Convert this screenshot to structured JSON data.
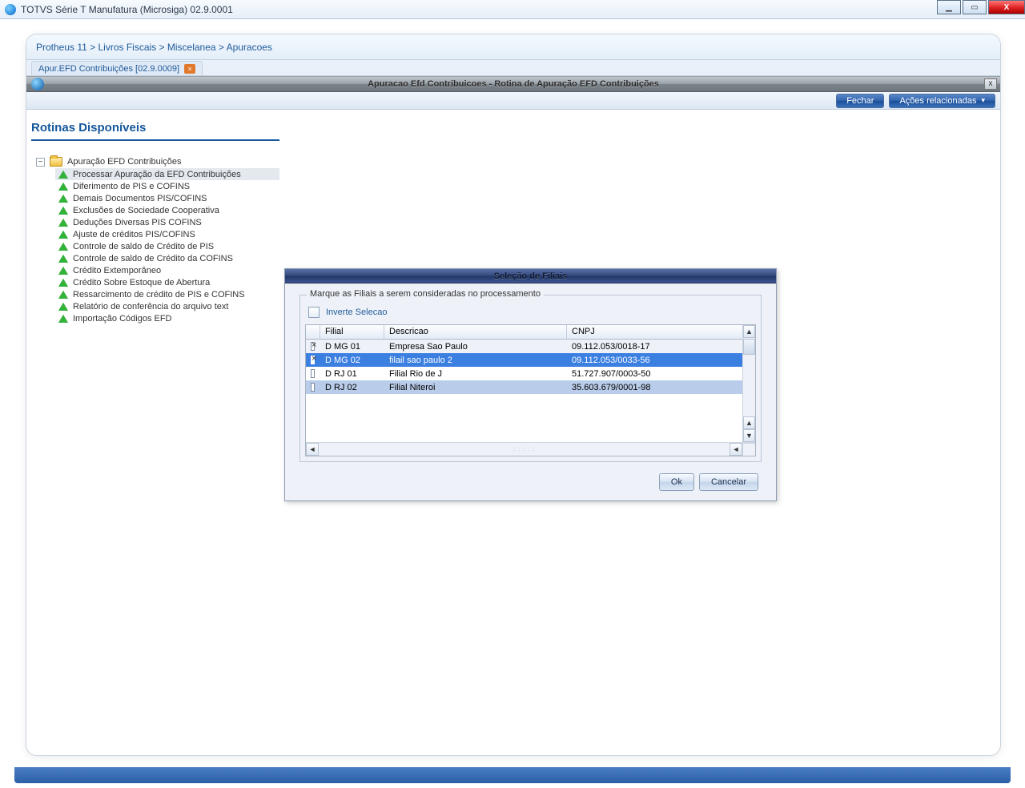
{
  "window": {
    "title": "TOTVS Série T Manufatura (Microsiga) 02.9.0001",
    "min": "▁",
    "max": "▭",
    "close": "X"
  },
  "breadcrumb": "Protheus 11 > Livros Fiscais > Miscelanea > Apuracoes",
  "tab": {
    "label": "Apur.EFD Contribuições [02.9.0009]",
    "close": "×"
  },
  "innerHeader": {
    "caption": "Apuracao Efd Contribuicoes - Rotina de Apuração EFD Contribuições",
    "close": "x"
  },
  "toolbar": {
    "close": "Fechar",
    "related": "Ações relacionadas"
  },
  "sidebar": {
    "title": "Rotinas Disponíveis",
    "toggle": "−",
    "root": "Apuração EFD Contribuições",
    "items": [
      "Processar Apuração da EFD Contribuições",
      "Diferimento de PIS e COFINS",
      "Demais Documentos PIS/COFINS",
      "Exclusões de Sociedade Cooperativa",
      "Deduções Diversas PIS COFINS",
      "Ajuste de créditos PIS/COFINS",
      "Controle de saldo de Crédito de PIS",
      "Controle de saldo de Crédito da COFINS",
      "Crédito Extemporâneo",
      "Crédito Sobre Estoque de Abertura",
      "Ressarcimento de crédito de PIS e COFINS",
      "Relatório de conferência do arquivo text",
      "Importação Códigos EFD"
    ]
  },
  "dialog": {
    "title": "Seleção de Filiais",
    "legend": "Marque as Filiais a serem consideradas no processamento",
    "invert": "Inverte Selecao",
    "headers": {
      "filial": "Filial",
      "descricao": "Descricao",
      "cnpj": "CNPJ"
    },
    "rows": [
      {
        "checked": true,
        "filial": "D MG 01",
        "descricao": "Empresa Sao Paulo",
        "cnpj": "09.112.053/0018-17"
      },
      {
        "checked": true,
        "filial": "D MG 02",
        "descricao": "filail sao paulo 2",
        "cnpj": "09.112.053/0033-56"
      },
      {
        "checked": false,
        "filial": "D RJ 01",
        "descricao": "Filial Rio de J",
        "cnpj": "51.727.907/0003-50"
      },
      {
        "checked": false,
        "filial": "D RJ 02",
        "descricao": "Filial Niteroi",
        "cnpj": "35.603.679/0001-98"
      }
    ],
    "ok": "Ok",
    "cancel": "Cancelar"
  }
}
